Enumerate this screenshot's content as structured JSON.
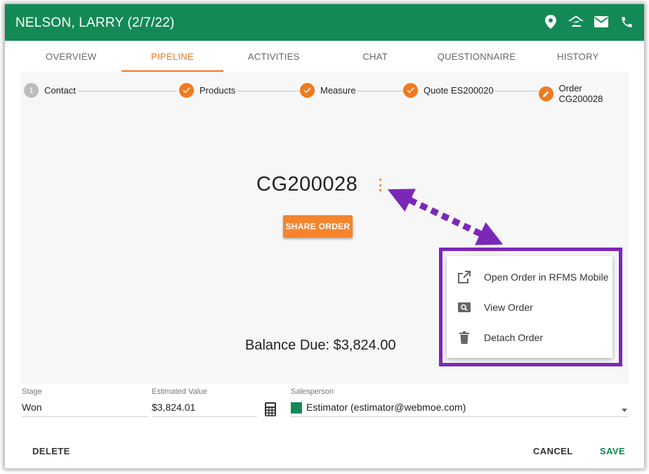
{
  "header": {
    "title": "NELSON, LARRY (2/7/22)",
    "icons": [
      "location-icon",
      "zillow-icon",
      "mail-icon",
      "phone-icon"
    ]
  },
  "tabs": [
    {
      "label": "OVERVIEW"
    },
    {
      "label": "PIPELINE",
      "active": true
    },
    {
      "label": "ACTIVITIES"
    },
    {
      "label": "CHAT"
    },
    {
      "label": "QUESTIONNAIRE"
    },
    {
      "label": "HISTORY"
    }
  ],
  "stepper": {
    "steps": [
      {
        "number": "1",
        "label": "Contact",
        "state": "pending"
      },
      {
        "label": "Products",
        "state": "done"
      },
      {
        "label": "Measure",
        "state": "done"
      },
      {
        "label": "Quote ES200020",
        "state": "done"
      },
      {
        "label": "Order CG200028",
        "state": "current"
      }
    ]
  },
  "order": {
    "title": "CG200028",
    "share_label": "SHARE ORDER",
    "balance": "Balance Due: $3,824.00"
  },
  "menu": {
    "items": [
      {
        "label": "Open Order in RFMS Mobile",
        "icon": "open-external-icon"
      },
      {
        "label": "View Order",
        "icon": "view-search-icon"
      },
      {
        "label": "Detach Order",
        "icon": "trash-icon"
      }
    ]
  },
  "fields": {
    "stage_label": "Stage",
    "stage_value": "Won",
    "estimated_label": "Estimated Value",
    "estimated_value": "$3,824.01",
    "salesperson_label": "Salesperson",
    "salesperson_value": "Estimator (estimator@webmoe.com)"
  },
  "footer": {
    "delete_label": "DELETE",
    "cancel_label": "CANCEL",
    "save_label": "SAVE"
  },
  "colors": {
    "header_green": "#138a55",
    "accent_orange": "#f07a20",
    "highlight_purple": "#7d27b9"
  }
}
